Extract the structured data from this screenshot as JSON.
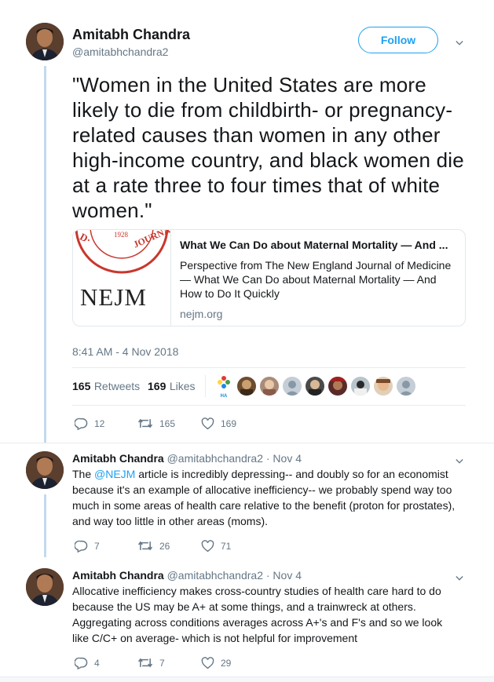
{
  "main_tweet": {
    "author_name": "Amitabh Chandra",
    "author_handle": "@amitabhchandra2",
    "follow_label": "Follow",
    "text": "\"Women in the United States are more likely to die from childbirth- or pregnancy-related causes than women in any other high-income country, and black women die at a rate three to four times that of white women.\"",
    "card": {
      "logo_text": "NEJM",
      "seal_year": "1928",
      "seal_text": "JOURNAL",
      "title": "What We Can Do about Maternal Mortality — And ...",
      "description": "Perspective from The New England Journal of Medicine — What We Can Do about Maternal Mortality — And How to Do It Quickly",
      "domain": "nejm.org"
    },
    "timestamp": "8:41 AM - 4 Nov 2018",
    "retweets_count": "165",
    "retweets_label": "Retweets",
    "likes_count": "169",
    "likes_label": "Likes",
    "liker_badge": "HA",
    "actions": {
      "replies": "12",
      "retweets": "165",
      "likes": "169"
    }
  },
  "replies": [
    {
      "author_name": "Amitabh Chandra",
      "author_handle": "@amitabhchandra2",
      "date": "· Nov 4",
      "text_pre": "The ",
      "mention": "@NEJM",
      "text_post": " article is incredibly depressing-- and doubly so for an economist because it's an example of allocative inefficiency-- we probably spend way too much in some areas of health care relative to the benefit (proton for prostates), and way too little in other areas (moms).",
      "actions": {
        "replies": "7",
        "retweets": "26",
        "likes": "71"
      }
    },
    {
      "author_name": "Amitabh Chandra",
      "author_handle": "@amitabhchandra2",
      "date": "· Nov 4",
      "text": "Allocative inefficiency makes cross-country studies of health care hard to do because the US may be A+ at some things, and a trainwreck at others. Aggregating across conditions averages across A+'s and F's and so we look like C/C+ on average- which is not helpful for improvement",
      "actions": {
        "replies": "4",
        "retweets": "7",
        "likes": "29"
      }
    }
  ],
  "colors": {
    "accent": "#1da1f2",
    "secondary_text": "#657786",
    "thread_line": "#c4d9ec",
    "nejm_red": "#c8372d"
  }
}
